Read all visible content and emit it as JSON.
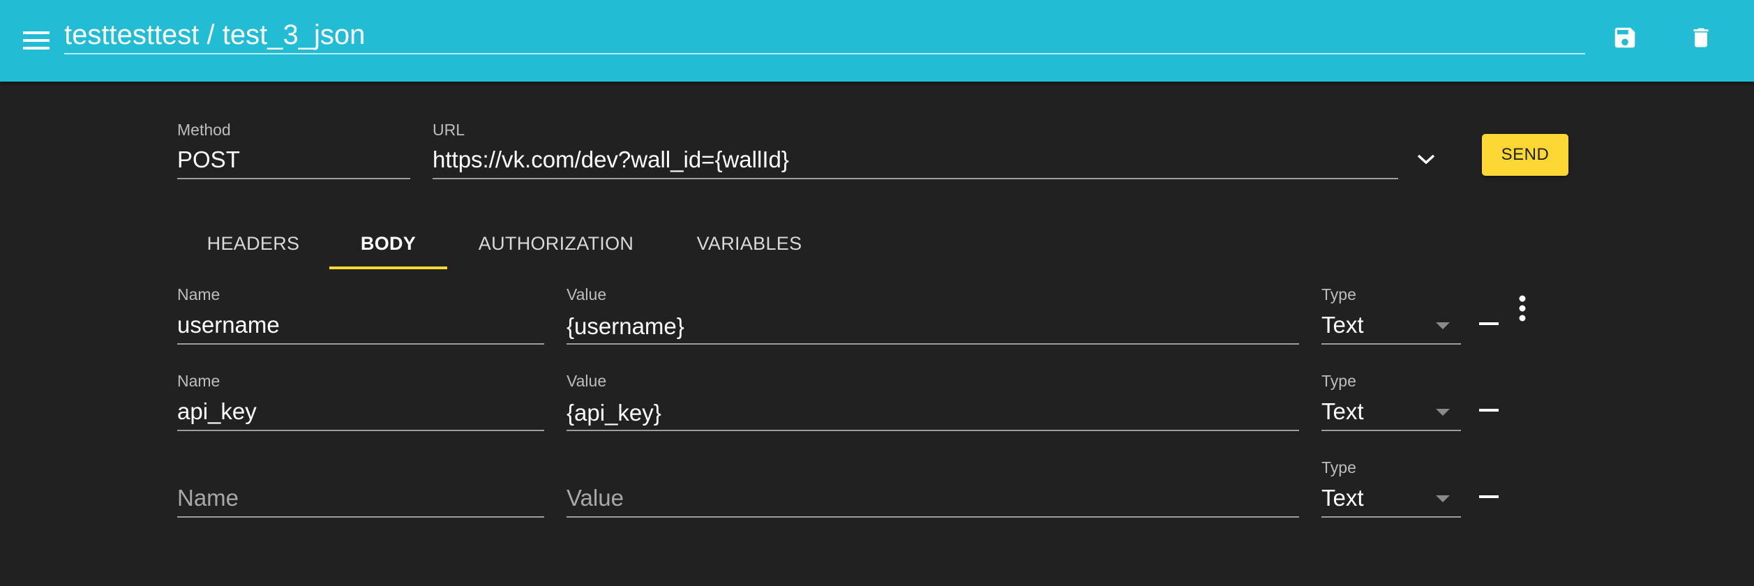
{
  "header": {
    "title": "testtesttest / test_3_json",
    "menu_icon": "menu-icon",
    "save_icon": "save-icon",
    "delete_icon": "delete-icon"
  },
  "request": {
    "method_label": "Method",
    "method_value": "POST",
    "url_label": "URL",
    "url_value": "https://vk.com/dev?wall_id={wallId}",
    "send_label": "SEND"
  },
  "tabs": [
    {
      "label": "HEADERS",
      "active": false
    },
    {
      "label": "BODY",
      "active": true
    },
    {
      "label": "AUTHORIZATION",
      "active": false
    },
    {
      "label": "VARIABLES",
      "active": false
    }
  ],
  "body_rows": [
    {
      "name_label": "Name",
      "name": "username",
      "value_label": "Value",
      "value": "{username}",
      "type_label": "Type",
      "type": "Text"
    },
    {
      "name_label": "Name",
      "name": "api_key",
      "value_label": "Value",
      "value": "{api_key}",
      "type_label": "Type",
      "type": "Text"
    },
    {
      "name_placeholder": "Name",
      "value_placeholder": "Value",
      "type_label": "Type",
      "type": "Text"
    }
  ],
  "colors": {
    "appbar": "#22bcd4",
    "background": "#212121",
    "accent": "#fdd835"
  }
}
